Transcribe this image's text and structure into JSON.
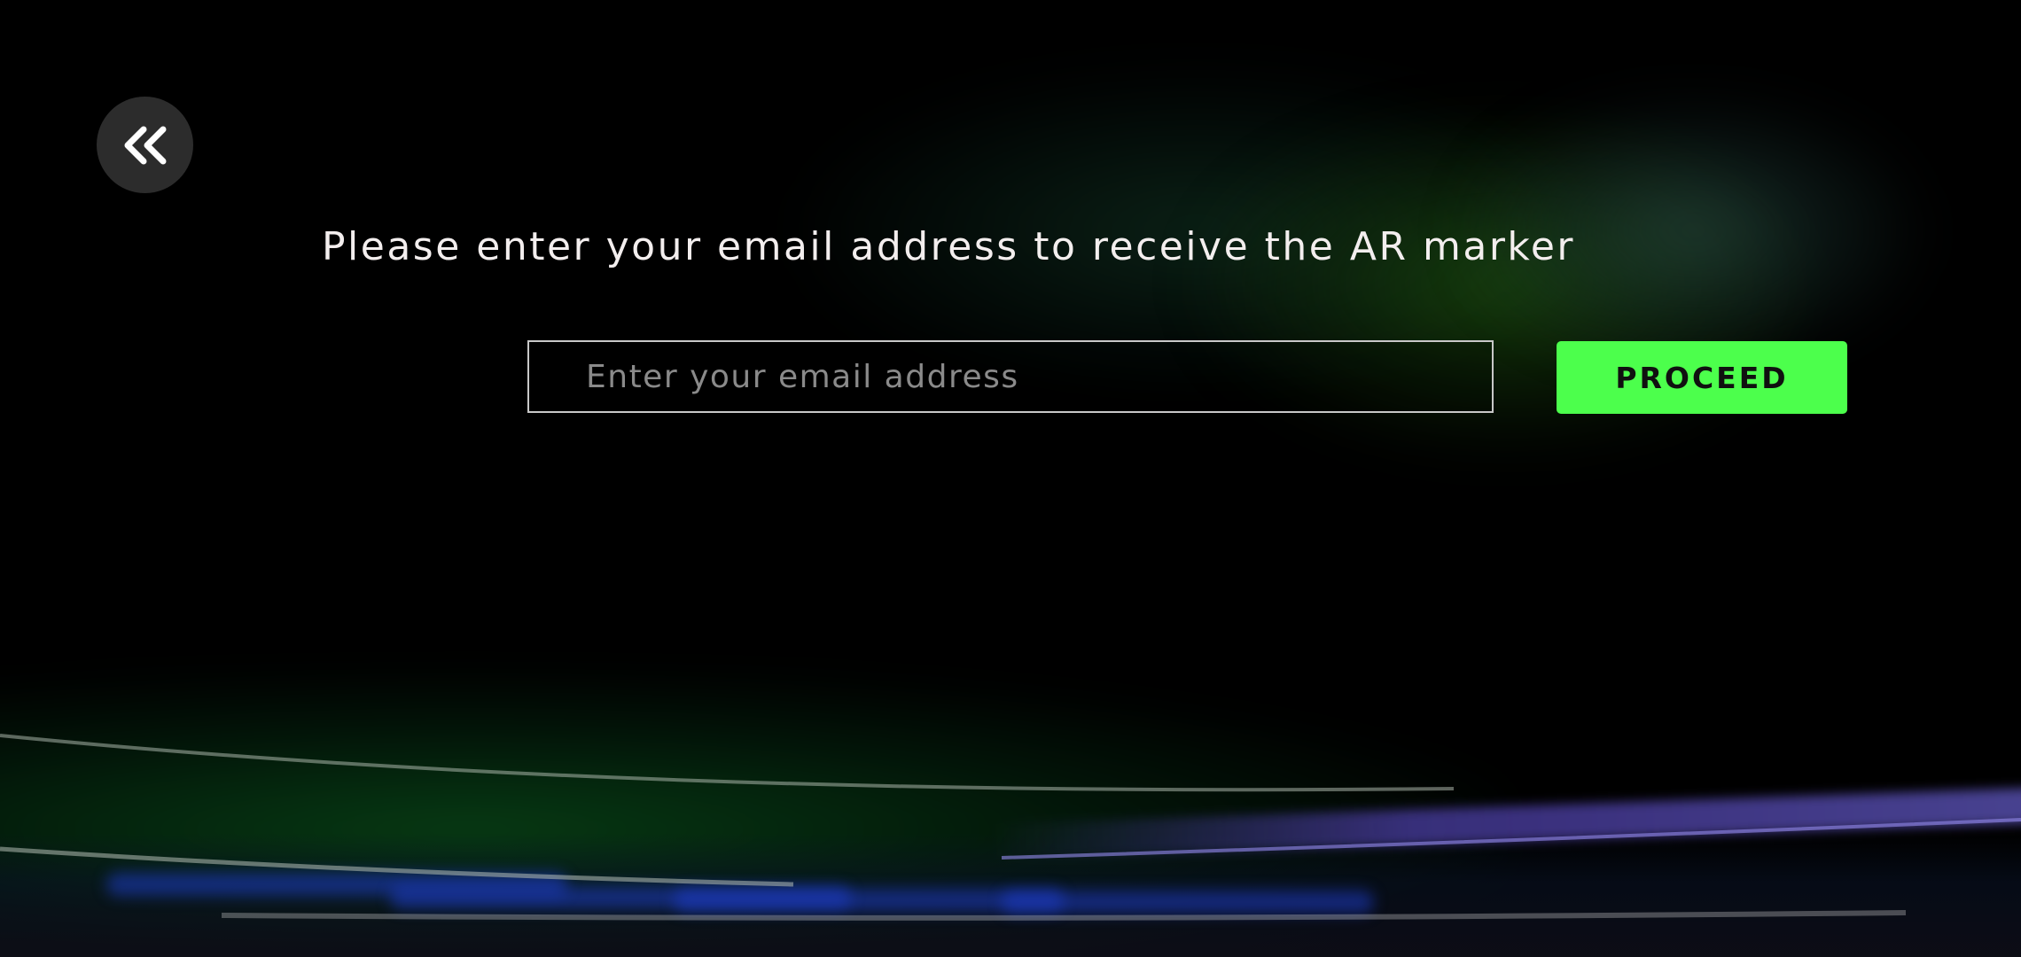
{
  "back_button": {
    "icon": "double-chevron-left-icon"
  },
  "prompt": {
    "text": "Please enter your email address to receive the AR marker"
  },
  "email_input": {
    "placeholder": "Enter your email address",
    "value": ""
  },
  "proceed_button": {
    "label": "PROCEED"
  },
  "colors": {
    "background": "#000000",
    "accent": "#4cff4c",
    "back_button_bg": "#2c2c2c",
    "prompt_text": "#f3eeee",
    "input_border": "#c8c8c8",
    "placeholder_text": "#8a8a8a"
  }
}
